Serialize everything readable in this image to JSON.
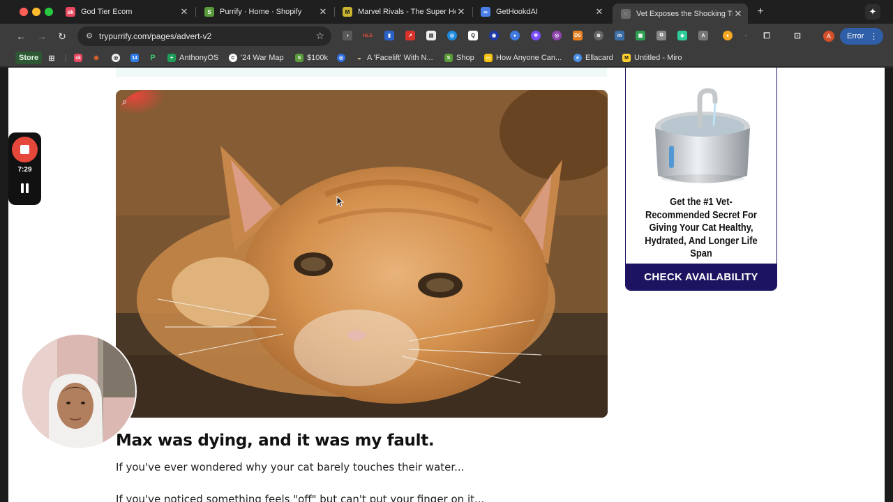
{
  "tabs": [
    {
      "title": "God Tier Ecom",
      "icon": "sk-logo-icon",
      "color": "#e8475f",
      "glyph": "sk"
    },
    {
      "title": "Purrify · Home · Shopify",
      "icon": "shopify-icon",
      "color": "#5a9b3a",
      "glyph": "S"
    },
    {
      "title": "Marvel Rivals - The Super He",
      "icon": "marvel-rivals-icon",
      "color": "#c8b431",
      "glyph": "M"
    },
    {
      "title": "GetHookdAI",
      "icon": "link-icon",
      "color": "#4a7fe8",
      "glyph": "∞"
    },
    {
      "title": "Vet Exposes the Shocking Tru",
      "icon": "globe-icon",
      "color": "#777777",
      "glyph": "◌",
      "active": true
    }
  ],
  "toolbar": {
    "url": "trypurrify.com/pages/advert-v2",
    "profile_initial": "A",
    "error_label": "Error"
  },
  "bookmarks": [
    {
      "label": "Store"
    },
    {
      "label": ""
    },
    {
      "label": ""
    },
    {
      "label": ""
    },
    {
      "label": ""
    },
    {
      "label": ""
    },
    {
      "label": "AnthonyOS"
    },
    {
      "label": "'24 War Map"
    },
    {
      "label": "$100k"
    },
    {
      "label": ""
    },
    {
      "label": "A 'Facelift' With N..."
    },
    {
      "label": "Shop"
    },
    {
      "label": "How Anyone Can..."
    },
    {
      "label": "Ellacard"
    },
    {
      "label": "Untitled - Miro"
    }
  ],
  "article": {
    "headline": "Max was dying, and it was my fault.",
    "paragraph1": "If you've ever wondered why your cat barely touches their water...",
    "paragraph2": "If you've noticed something feels \"off\" but can't put your finger on it..."
  },
  "ad": {
    "text": "Get the #1 Vet-Recommended Secret For Giving Your Cat Healthy, Hydrated, And Longer Life Span",
    "cta": "CHECK AVAILABILITY",
    "brand_color": "#1c1460"
  },
  "recorder": {
    "time": "7:29"
  }
}
